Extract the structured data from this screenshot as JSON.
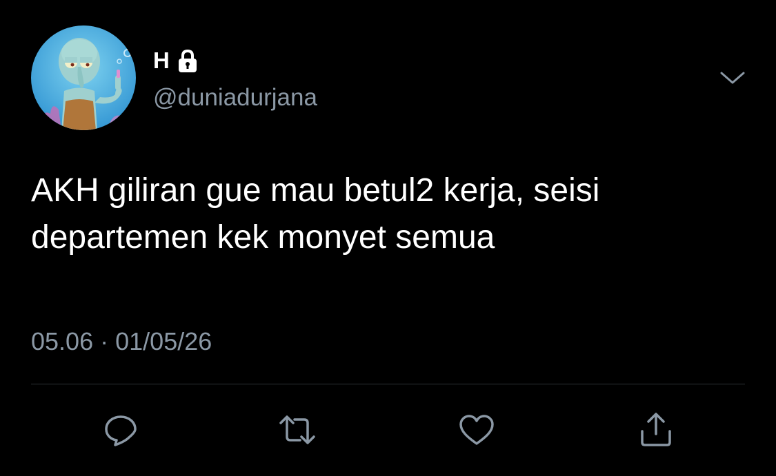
{
  "tweet": {
    "display_name": "H",
    "handle": "@duniadurjana",
    "text": "AKH giliran gue mau betul2 kerja, seisi departemen kek monyet semua",
    "time": "05.06",
    "separator": "·",
    "date": "01/05/26"
  },
  "icons": {
    "protected": "lock-icon",
    "menu": "chevron-down-icon",
    "reply": "reply-icon",
    "retweet": "retweet-icon",
    "like": "heart-icon",
    "share": "share-icon"
  },
  "colors": {
    "background": "#000000",
    "text_primary": "#ffffff",
    "text_secondary": "#8b98a5",
    "divider": "#2f3336"
  }
}
